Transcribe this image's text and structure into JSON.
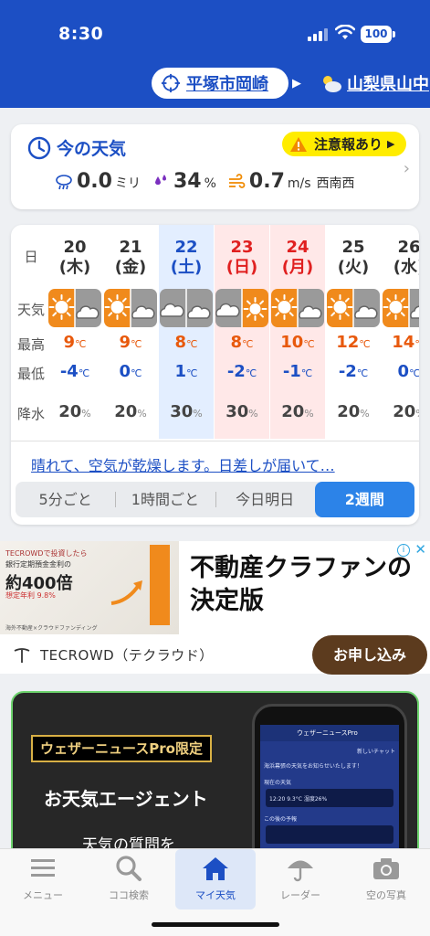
{
  "status": {
    "time": "8:30",
    "battery": "100"
  },
  "location": {
    "current": "平塚市岡崎",
    "next": "山梨県山中"
  },
  "now": {
    "title": "今の天気",
    "alert_label": "注意報あり",
    "rain_value": "0.0",
    "rain_unit": "ミリ",
    "humidity_value": "34",
    "humidity_unit": "%",
    "wind_value": "0.7",
    "wind_unit": "m/s",
    "wind_dir": "西南西"
  },
  "week": {
    "row_labels": {
      "day": "日",
      "weather": "天気",
      "max": "最高",
      "min": "最低",
      "precip": "降水"
    },
    "temp_unit": "℃",
    "precip_unit": "%",
    "days": [
      {
        "date": "20",
        "dow": "(木)",
        "max": "9",
        "min": "-4",
        "precip": "20",
        "icon": "sun-cloud"
      },
      {
        "date": "21",
        "dow": "(金)",
        "max": "9",
        "min": "0",
        "precip": "20",
        "icon": "sun-cloud"
      },
      {
        "date": "22",
        "dow": "(土)",
        "max": "8",
        "min": "1",
        "precip": "30",
        "icon": "cloud-cloud"
      },
      {
        "date": "23",
        "dow": "(日)",
        "max": "8",
        "min": "-2",
        "precip": "30",
        "icon": "cloud-sun"
      },
      {
        "date": "24",
        "dow": "(月)",
        "max": "10",
        "min": "-1",
        "precip": "20",
        "icon": "sun-cloud"
      },
      {
        "date": "25",
        "dow": "(火)",
        "max": "12",
        "min": "-2",
        "precip": "20",
        "icon": "sun-cloud"
      },
      {
        "date": "26",
        "dow": "(水)",
        "max": "14",
        "min": "0",
        "precip": "20",
        "icon": "sun-cloud"
      }
    ],
    "message": "晴れて、空気が乾燥します。日差しが届いて…",
    "segments": [
      "5分ごと",
      "1時間ごと",
      "今日明日",
      "2週間"
    ],
    "active_segment": "2週間"
  },
  "ad": {
    "img_line1": "TECROWDで投資したら",
    "img_line2": "銀行定期預金金利の",
    "img_line3": "約400倍",
    "img_line4": "想定年利 9.8%",
    "img_line5": "海外不動産×クラウドファンディング",
    "headline": "不動産クラファンの決定版",
    "brand": "TECROWD（テクラウド）",
    "cta": "お申し込み"
  },
  "promo": {
    "tag": "ウェザーニュースPro限定",
    "title": "お天気エージェント",
    "subtitle": "天気の質問を",
    "phone_header": "ウェザーニュースPro",
    "phone_link": "新しいチャット",
    "phone_msg": "海浜幕張の天気をお知らせいたします！",
    "phone_now": "現在の天気",
    "phone_now_row": "12:20   9.3°C   湿度26%",
    "phone_later": "この後の予報"
  },
  "nav": {
    "menu": "メニュー",
    "search": "ココ検索",
    "my_weather": "マイ天気",
    "radar": "レーダー",
    "photos": "空の写真"
  },
  "colors": {
    "brand_blue": "#1c4fc4",
    "max_temp": "#e8590c",
    "min_temp": "#1c4fc4",
    "alert": "#ffec00"
  }
}
